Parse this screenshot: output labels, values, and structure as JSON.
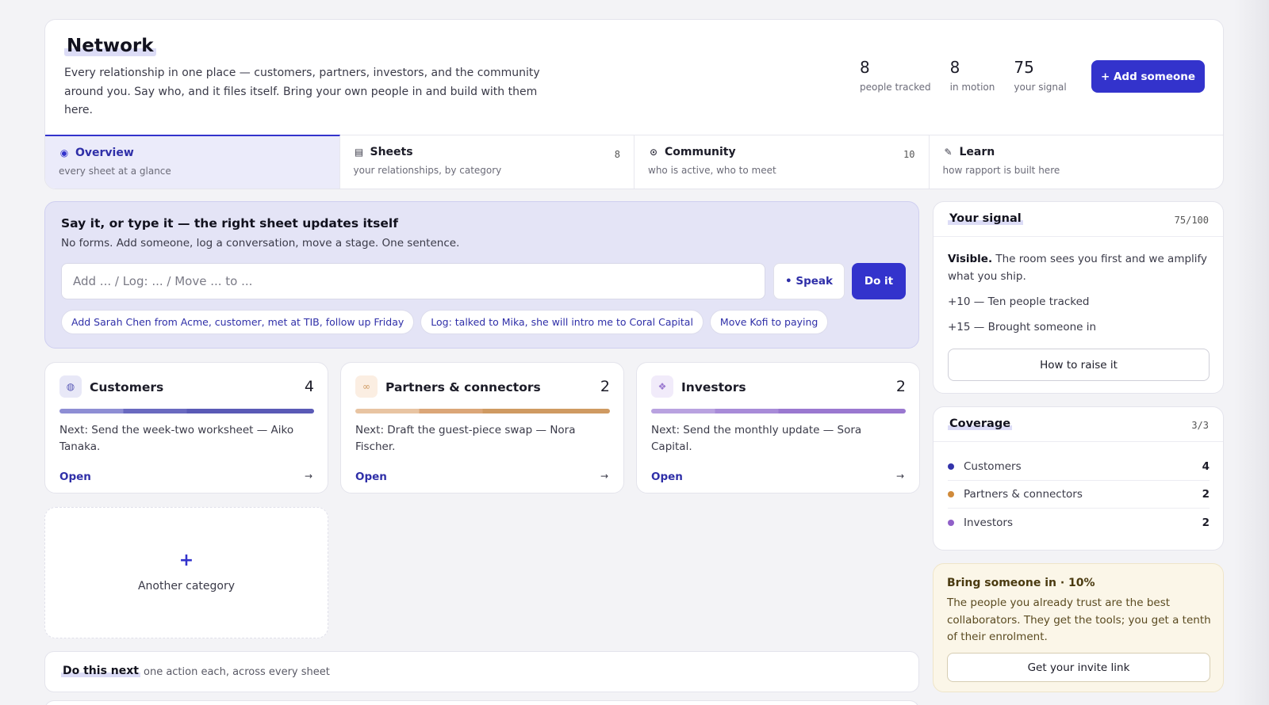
{
  "header": {
    "title": "Network",
    "description": "Every relationship in one place — customers, partners, investors, and the community around you. Say who, and it files itself. Bring your own people in and build with them here.",
    "stats": [
      {
        "value": "8",
        "label": "people tracked"
      },
      {
        "value": "8",
        "label": "in motion"
      },
      {
        "value": "75",
        "label": "your signal"
      }
    ],
    "add_button": "+ Add someone"
  },
  "tabs": [
    {
      "icon": "◉",
      "icon_name": "overview-icon",
      "title": "Overview",
      "subtitle": "every sheet at a glance",
      "count": "",
      "active": true
    },
    {
      "icon": "▤",
      "icon_name": "sheets-icon",
      "title": "Sheets",
      "subtitle": "your relationships, by category",
      "count": "8",
      "active": false
    },
    {
      "icon": "⊙",
      "icon_name": "community-icon",
      "title": "Community",
      "subtitle": "who is active, who to meet",
      "count": "10",
      "active": false
    },
    {
      "icon": "✎",
      "icon_name": "pencil-icon",
      "title": "Learn",
      "subtitle": "how rapport is built here",
      "count": "",
      "active": false
    }
  ],
  "command": {
    "title": "Say it, or type it — the right sheet updates itself",
    "subtitle": "No forms. Add someone, log a conversation, move a stage. One sentence.",
    "placeholder": "Add ... / Log: ... / Move ... to ...",
    "speak_button": "• Speak",
    "do_button": "Do it",
    "suggestions": [
      "Add Sarah Chen from Acme, customer, met at TIB, follow up Friday",
      "Log: talked to Mika, she will intro me to Coral Capital",
      "Move Kofi to paying"
    ]
  },
  "categories": [
    {
      "icon": "◍",
      "icon_name": "customers-icon",
      "name": "Customers",
      "count": "4",
      "next": "Next: Send the week-two worksheet — Aiko Tanaka.",
      "open": "Open",
      "arrow": "→",
      "colors": [
        "#8e8ed4",
        "#6a6ac0",
        "#5a5ab6"
      ],
      "icon_bg": "#e8e8f7",
      "icon_color": "#5a5ab6"
    },
    {
      "icon": "∞",
      "icon_name": "link-icon",
      "name": "Partners & connectors",
      "count": "2",
      "next": "Next: Draft the guest-piece swap — Nora Fischer.",
      "open": "Open",
      "arrow": "→",
      "colors": [
        "#e8c4a2",
        "#dba678",
        "#cf9a62"
      ],
      "icon_bg": "#fbeee2",
      "icon_color": "#cf9a62"
    },
    {
      "icon": "❖",
      "icon_name": "investors-icon",
      "name": "Investors",
      "count": "2",
      "next": "Next: Send the monthly update — Sora Capital.",
      "open": "Open",
      "arrow": "→",
      "colors": [
        "#b9a2e0",
        "#a88bd8",
        "#9a78d0"
      ],
      "icon_bg": "#f1ebfa",
      "icon_color": "#9a78d0"
    }
  ],
  "add_category": {
    "plus": "+",
    "label": "Another category"
  },
  "do_next": {
    "title": "Do this next",
    "subtitle": "one action each, across every sheet"
  },
  "signal": {
    "title": "Your signal",
    "score": "75/100",
    "lead": "Visible.",
    "text": " The room sees you first and we amplify what you ship.",
    "items": [
      "+10 — Ten people tracked",
      "+15 — Brought someone in"
    ],
    "button": "How to raise it"
  },
  "coverage": {
    "title": "Coverage",
    "meta": "3/3",
    "rows": [
      {
        "name": "Customers",
        "count": "4",
        "color": "#3333aa"
      },
      {
        "name": "Partners & connectors",
        "count": "2",
        "color": "#d08a3a"
      },
      {
        "name": "Investors",
        "count": "2",
        "color": "#9060c8"
      }
    ]
  },
  "invite": {
    "title": "Bring someone in · 10%",
    "text": "The people you already trust are the best collaborators. They get the tools; you get a tenth of their enrolment.",
    "button": "Get your invite link"
  },
  "colors": {
    "accent": "#3333cc",
    "page_bg": "#f3f3f6",
    "command_bg": "#e4e4f6",
    "invite_bg": "#fbf6e8"
  }
}
